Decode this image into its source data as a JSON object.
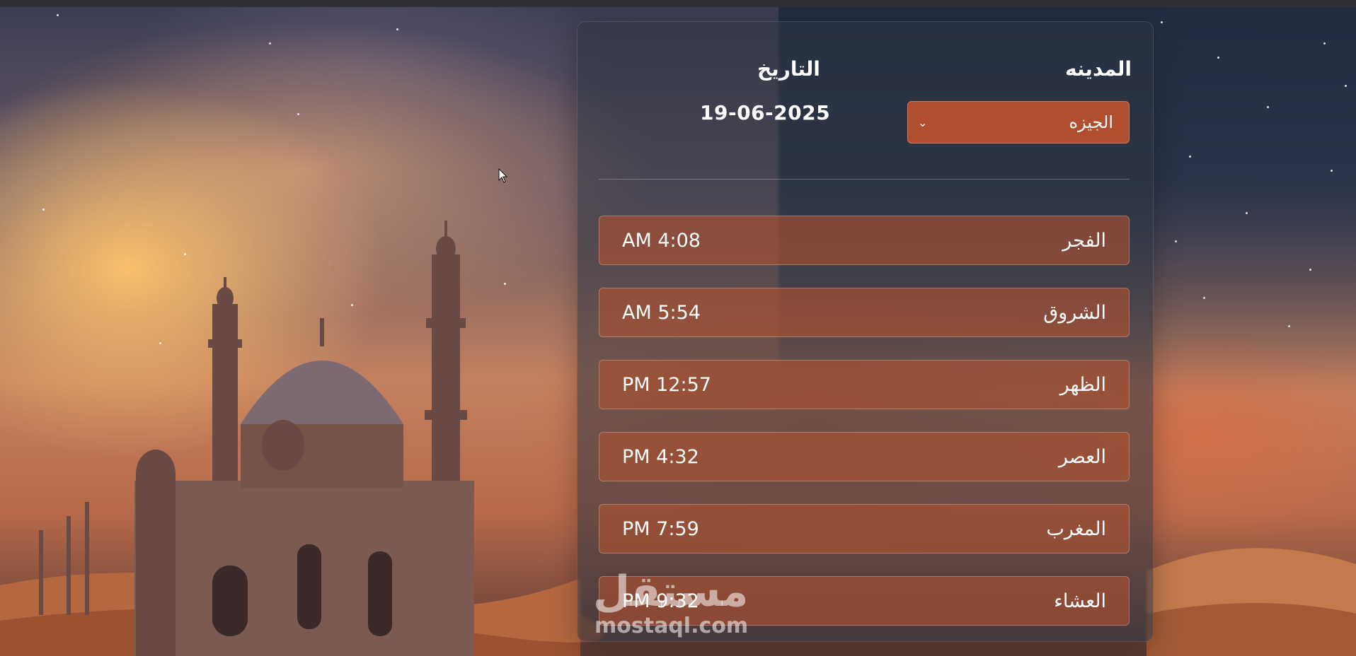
{
  "header": {
    "city_label": "المدينه",
    "date_label": "التاريخ",
    "date_value": "19-06-2025"
  },
  "city_select": {
    "selected": "الجيزه"
  },
  "prayers": [
    {
      "name": "الفجر",
      "time": "AM 4:08"
    },
    {
      "name": "الشروق",
      "time": "AM 5:54"
    },
    {
      "name": "الظهر",
      "time": "PM 12:57"
    },
    {
      "name": "العصر",
      "time": "PM 4:32"
    },
    {
      "name": "المغرب",
      "time": "PM 7:59"
    },
    {
      "name": "العشاء",
      "time": "PM 9:32"
    }
  ],
  "watermark": {
    "arabic": "مستقل",
    "latin": "mostaql.com"
  },
  "colors": {
    "accent": "#b04e30",
    "card": "#2e3442"
  }
}
